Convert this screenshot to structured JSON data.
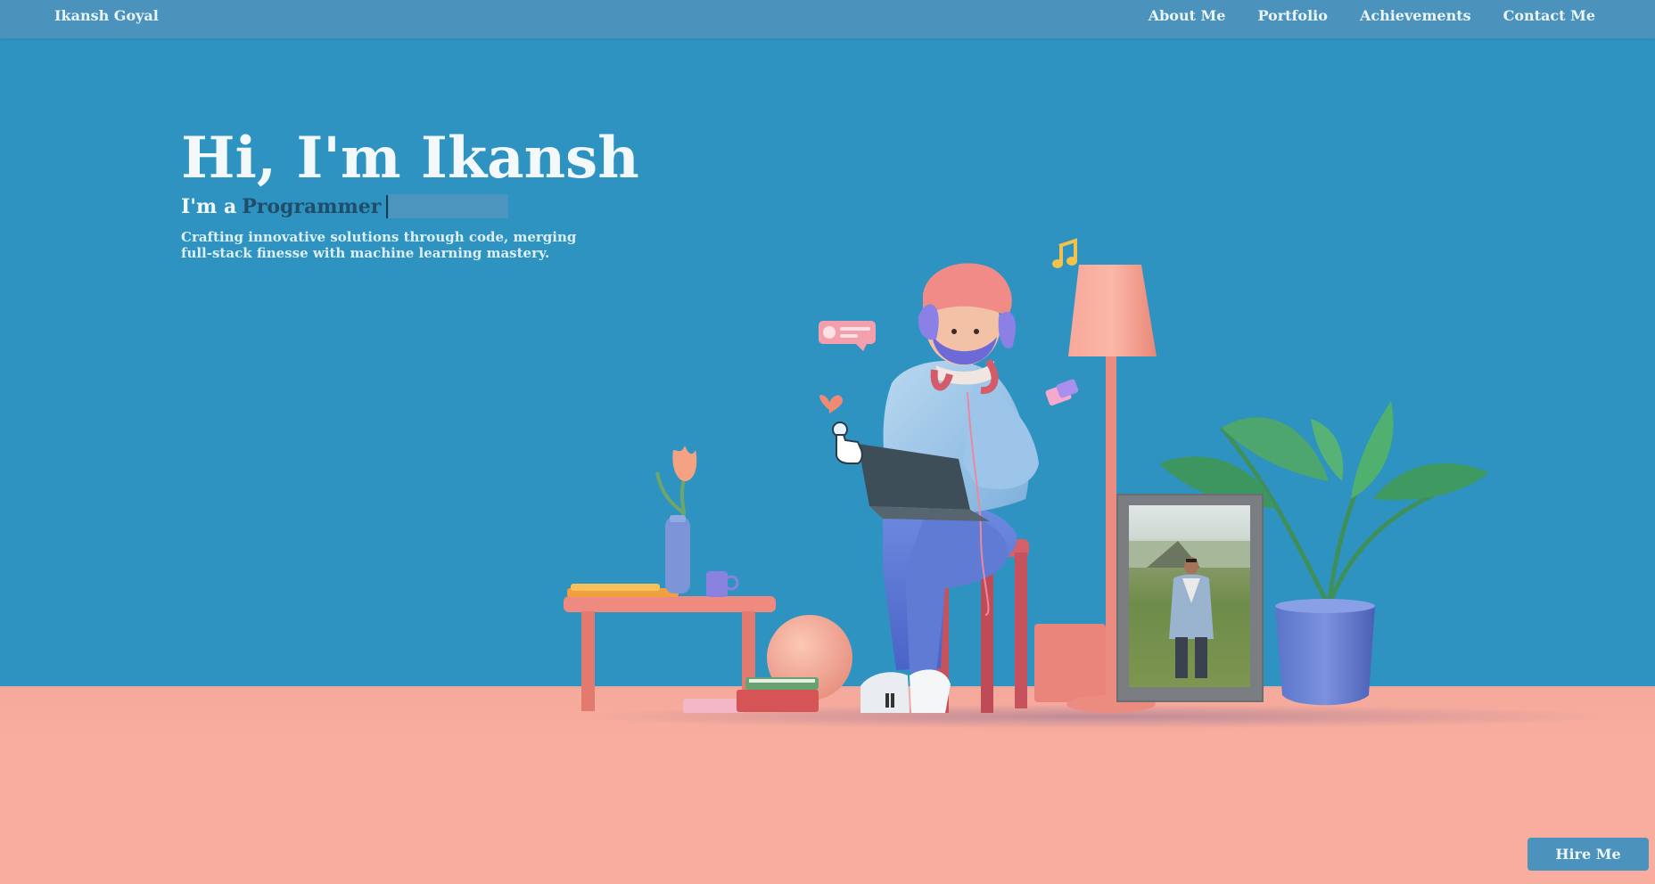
{
  "nav": {
    "brand": "Ikansh Goyal",
    "links": [
      "About Me",
      "Portfolio",
      "Achievements",
      "Contact Me"
    ]
  },
  "hero": {
    "title": "Hi, I'm Ikansh",
    "sub_prefix": "I'm a",
    "role": "Programmer",
    "description": "Crafting innovative solutions through code, merging full-stack finesse with machine learning mastery."
  },
  "cta": {
    "hire_label": "Hire Me"
  },
  "colors": {
    "background": "#2e93c0",
    "navbar": "#4b93bd",
    "floor": "#f9ad9e",
    "accent_dark": "#1f4d6a"
  },
  "icons": [
    "music-note-icon",
    "chat-bubble-icon",
    "heart-icon",
    "pointer-hand-icon",
    "message-cards-icon"
  ]
}
